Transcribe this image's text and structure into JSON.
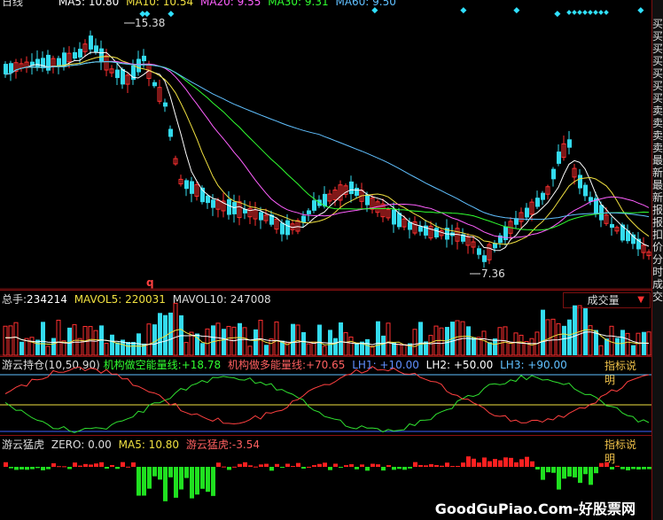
{
  "main_panel": {
    "legend": {
      "period": "日线",
      "ma5": "MA5: 10.80",
      "ma10": "MA10: 10.54",
      "ma20": "MA20: 9.55",
      "ma30": "MA30: 9.31",
      "ma60": "MA60: 9.50"
    },
    "high_price": "15.38",
    "low_price": "7.36",
    "marker": "q"
  },
  "volume_panel": {
    "total_label": "总手:",
    "total_value": "234214",
    "mavol5": "MAVOL5: 220031",
    "mavol10": "MAVOL10: 247008",
    "button": "成交量"
  },
  "indicator1": {
    "title": "游云持仓(10,50,90)",
    "short_label": "机构做空能量线:",
    "short_value": "+18.78",
    "long_label": "机构做多能量线:",
    "long_value": "+70.65",
    "lh1": "LH1: +10.00",
    "lh2": "LH2: +50.00",
    "lh3": "LH3: +90.00",
    "help": "指标说明"
  },
  "indicator2": {
    "title": "游云猛虎",
    "zero": "ZERO: 0.00",
    "ma5": "MA5: 10.80",
    "tiger_label": "游云猛虎:",
    "tiger_value": "-3.54",
    "help": "指标说明"
  },
  "side_strip_text": "买买买买买买买卖卖卖卖最新最新报报扣价分时成交",
  "watermark": "GoodGuPiao.Com-好股票网",
  "colors": {
    "up": "#ff3030",
    "down": "#33dbee",
    "ma5": "#ffffff",
    "ma10": "#f0e040",
    "ma20": "#ff60ff",
    "ma30": "#30ff30",
    "ma60": "#60c0ff"
  }
}
